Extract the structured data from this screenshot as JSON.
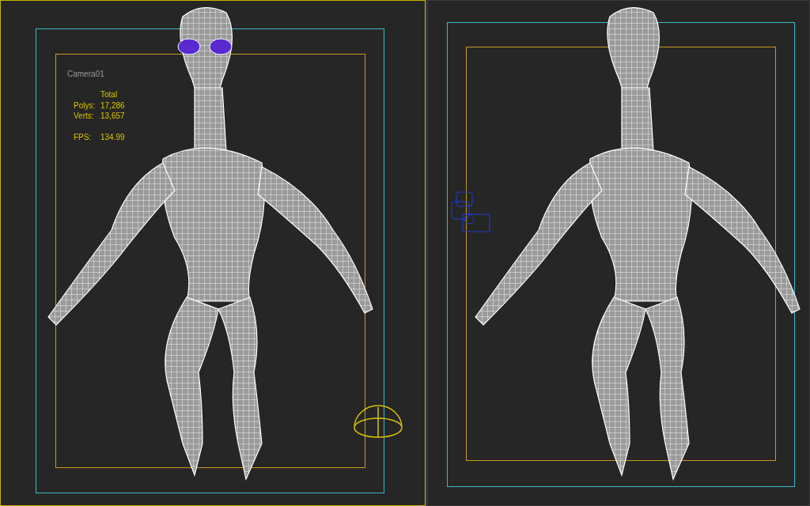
{
  "viewports": [
    {
      "active": true,
      "label": "Camera01",
      "stats": {
        "header": "Total",
        "rows": [
          {
            "label": "Polys:",
            "value": "17,286"
          },
          {
            "label": "Verts:",
            "value": "13,657"
          },
          {
            "label": "FPS:",
            "value": "134.99",
            "gap": true
          }
        ]
      }
    },
    {
      "active": false
    }
  ]
}
